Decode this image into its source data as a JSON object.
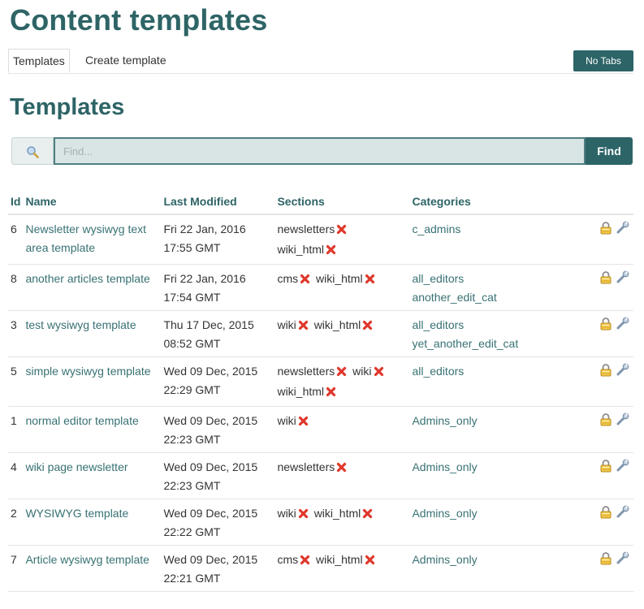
{
  "page": {
    "title": "Content templates",
    "section_title": "Templates"
  },
  "tabs": {
    "templates": "Templates",
    "create": "Create template",
    "no_tabs": "No Tabs"
  },
  "search": {
    "placeholder": "Find...",
    "find_label": "Find"
  },
  "table": {
    "headers": {
      "id": "Id",
      "name": "Name",
      "modified": "Last Modified",
      "sections": "Sections",
      "categories": "Categories"
    },
    "rows": [
      {
        "id": "6",
        "name": "Newsletter wysiwyg text area template",
        "modified": "Fri 22 Jan, 2016 17:55 GMT",
        "sections": [
          "newsletters",
          "wiki_html"
        ],
        "categories": [
          "c_admins"
        ]
      },
      {
        "id": "8",
        "name": "another articles template",
        "modified": "Fri 22 Jan, 2016 17:54 GMT",
        "sections": [
          "cms",
          "wiki_html"
        ],
        "categories": [
          "all_editors",
          "another_edit_cat"
        ]
      },
      {
        "id": "3",
        "name": "test wysiwyg template",
        "modified": "Thu 17 Dec, 2015 08:52 GMT",
        "sections": [
          "wiki",
          "wiki_html"
        ],
        "categories": [
          "all_editors",
          "yet_another_edit_cat"
        ]
      },
      {
        "id": "5",
        "name": "simple wysiwyg template",
        "modified": "Wed 09 Dec, 2015 22:29 GMT",
        "sections": [
          "newsletters",
          "wiki",
          "wiki_html"
        ],
        "categories": [
          "all_editors"
        ]
      },
      {
        "id": "1",
        "name": "normal editor template",
        "modified": "Wed 09 Dec, 2015 22:23 GMT",
        "sections": [
          "wiki"
        ],
        "categories": [
          "Admins_only"
        ]
      },
      {
        "id": "4",
        "name": "wiki page newsletter",
        "modified": "Wed 09 Dec, 2015 22:23 GMT",
        "sections": [
          "newsletters"
        ],
        "categories": [
          "Admins_only"
        ]
      },
      {
        "id": "2",
        "name": "WYSIWYG template",
        "modified": "Wed 09 Dec, 2015 22:22 GMT",
        "sections": [
          "wiki",
          "wiki_html"
        ],
        "categories": [
          "Admins_only"
        ]
      },
      {
        "id": "7",
        "name": "Article wysiwyg template",
        "modified": "Wed 09 Dec, 2015 22:21 GMT",
        "sections": [
          "cms",
          "wiki_html"
        ],
        "categories": [
          "Admins_only"
        ]
      }
    ]
  },
  "icons": {
    "search": "search-icon",
    "remove": "remove-x-icon",
    "lock": "lock-icon",
    "edit": "wrench-icon"
  },
  "colors": {
    "accent": "#2e6466",
    "button": "#2c6467",
    "link": "#387173",
    "remove": "#e0382c",
    "lock": "#e2b237"
  }
}
